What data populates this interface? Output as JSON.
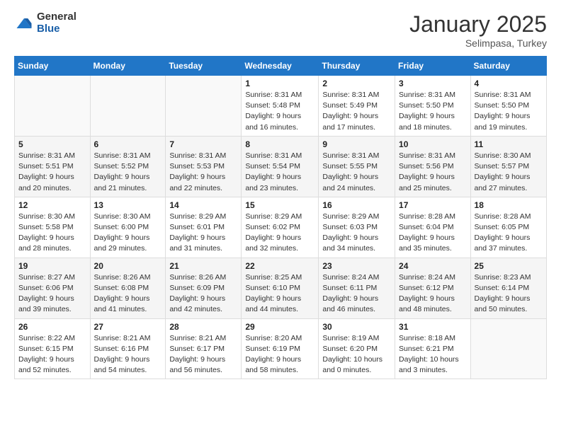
{
  "logo": {
    "general": "General",
    "blue": "Blue"
  },
  "header": {
    "month": "January 2025",
    "location": "Selimpasa, Turkey"
  },
  "weekdays": [
    "Sunday",
    "Monday",
    "Tuesday",
    "Wednesday",
    "Thursday",
    "Friday",
    "Saturday"
  ],
  "rows": [
    [
      {
        "day": "",
        "empty": true
      },
      {
        "day": "",
        "empty": true
      },
      {
        "day": "",
        "empty": true
      },
      {
        "day": "1",
        "sunrise": "8:31 AM",
        "sunset": "5:48 PM",
        "daylight": "9 hours and 16 minutes."
      },
      {
        "day": "2",
        "sunrise": "8:31 AM",
        "sunset": "5:49 PM",
        "daylight": "9 hours and 17 minutes."
      },
      {
        "day": "3",
        "sunrise": "8:31 AM",
        "sunset": "5:50 PM",
        "daylight": "9 hours and 18 minutes."
      },
      {
        "day": "4",
        "sunrise": "8:31 AM",
        "sunset": "5:50 PM",
        "daylight": "9 hours and 19 minutes."
      }
    ],
    [
      {
        "day": "5",
        "sunrise": "8:31 AM",
        "sunset": "5:51 PM",
        "daylight": "9 hours and 20 minutes."
      },
      {
        "day": "6",
        "sunrise": "8:31 AM",
        "sunset": "5:52 PM",
        "daylight": "9 hours and 21 minutes."
      },
      {
        "day": "7",
        "sunrise": "8:31 AM",
        "sunset": "5:53 PM",
        "daylight": "9 hours and 22 minutes."
      },
      {
        "day": "8",
        "sunrise": "8:31 AM",
        "sunset": "5:54 PM",
        "daylight": "9 hours and 23 minutes."
      },
      {
        "day": "9",
        "sunrise": "8:31 AM",
        "sunset": "5:55 PM",
        "daylight": "9 hours and 24 minutes."
      },
      {
        "day": "10",
        "sunrise": "8:31 AM",
        "sunset": "5:56 PM",
        "daylight": "9 hours and 25 minutes."
      },
      {
        "day": "11",
        "sunrise": "8:30 AM",
        "sunset": "5:57 PM",
        "daylight": "9 hours and 27 minutes."
      }
    ],
    [
      {
        "day": "12",
        "sunrise": "8:30 AM",
        "sunset": "5:58 PM",
        "daylight": "9 hours and 28 minutes."
      },
      {
        "day": "13",
        "sunrise": "8:30 AM",
        "sunset": "6:00 PM",
        "daylight": "9 hours and 29 minutes."
      },
      {
        "day": "14",
        "sunrise": "8:29 AM",
        "sunset": "6:01 PM",
        "daylight": "9 hours and 31 minutes."
      },
      {
        "day": "15",
        "sunrise": "8:29 AM",
        "sunset": "6:02 PM",
        "daylight": "9 hours and 32 minutes."
      },
      {
        "day": "16",
        "sunrise": "8:29 AM",
        "sunset": "6:03 PM",
        "daylight": "9 hours and 34 minutes."
      },
      {
        "day": "17",
        "sunrise": "8:28 AM",
        "sunset": "6:04 PM",
        "daylight": "9 hours and 35 minutes."
      },
      {
        "day": "18",
        "sunrise": "8:28 AM",
        "sunset": "6:05 PM",
        "daylight": "9 hours and 37 minutes."
      }
    ],
    [
      {
        "day": "19",
        "sunrise": "8:27 AM",
        "sunset": "6:06 PM",
        "daylight": "9 hours and 39 minutes."
      },
      {
        "day": "20",
        "sunrise": "8:26 AM",
        "sunset": "6:08 PM",
        "daylight": "9 hours and 41 minutes."
      },
      {
        "day": "21",
        "sunrise": "8:26 AM",
        "sunset": "6:09 PM",
        "daylight": "9 hours and 42 minutes."
      },
      {
        "day": "22",
        "sunrise": "8:25 AM",
        "sunset": "6:10 PM",
        "daylight": "9 hours and 44 minutes."
      },
      {
        "day": "23",
        "sunrise": "8:24 AM",
        "sunset": "6:11 PM",
        "daylight": "9 hours and 46 minutes."
      },
      {
        "day": "24",
        "sunrise": "8:24 AM",
        "sunset": "6:12 PM",
        "daylight": "9 hours and 48 minutes."
      },
      {
        "day": "25",
        "sunrise": "8:23 AM",
        "sunset": "6:14 PM",
        "daylight": "9 hours and 50 minutes."
      }
    ],
    [
      {
        "day": "26",
        "sunrise": "8:22 AM",
        "sunset": "6:15 PM",
        "daylight": "9 hours and 52 minutes."
      },
      {
        "day": "27",
        "sunrise": "8:21 AM",
        "sunset": "6:16 PM",
        "daylight": "9 hours and 54 minutes."
      },
      {
        "day": "28",
        "sunrise": "8:21 AM",
        "sunset": "6:17 PM",
        "daylight": "9 hours and 56 minutes."
      },
      {
        "day": "29",
        "sunrise": "8:20 AM",
        "sunset": "6:19 PM",
        "daylight": "9 hours and 58 minutes."
      },
      {
        "day": "30",
        "sunrise": "8:19 AM",
        "sunset": "6:20 PM",
        "daylight": "10 hours and 0 minutes."
      },
      {
        "day": "31",
        "sunrise": "8:18 AM",
        "sunset": "6:21 PM",
        "daylight": "10 hours and 3 minutes."
      },
      {
        "day": "",
        "empty": true
      }
    ]
  ],
  "labels": {
    "sunrise": "Sunrise:",
    "sunset": "Sunset:",
    "daylight": "Daylight:"
  }
}
